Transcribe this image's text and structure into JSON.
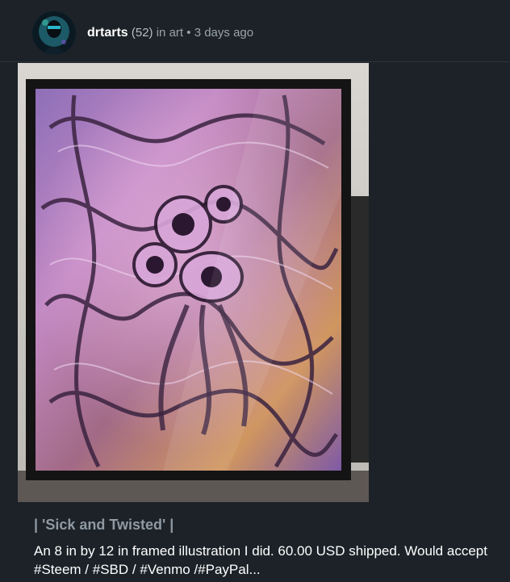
{
  "post": {
    "author": "drtarts",
    "reputation": "(52)",
    "in_label": "in",
    "category": "art",
    "separator": "•",
    "time_ago": "3 days ago",
    "image_icon": "framed-artwork-photo",
    "title": "| 'Sick and Twisted' |",
    "body": "An 8 in by 12 in framed illustration I did. 60.00 USD shipped. Would accept #Steem / #SBD / #Venmo /#PayPal..."
  },
  "colors": {
    "background": "#1c2228",
    "author_text": "#ffffff",
    "meta_text": "#9aa3ab",
    "title_text": "#8f99a3",
    "body_text": "#ffffff"
  }
}
